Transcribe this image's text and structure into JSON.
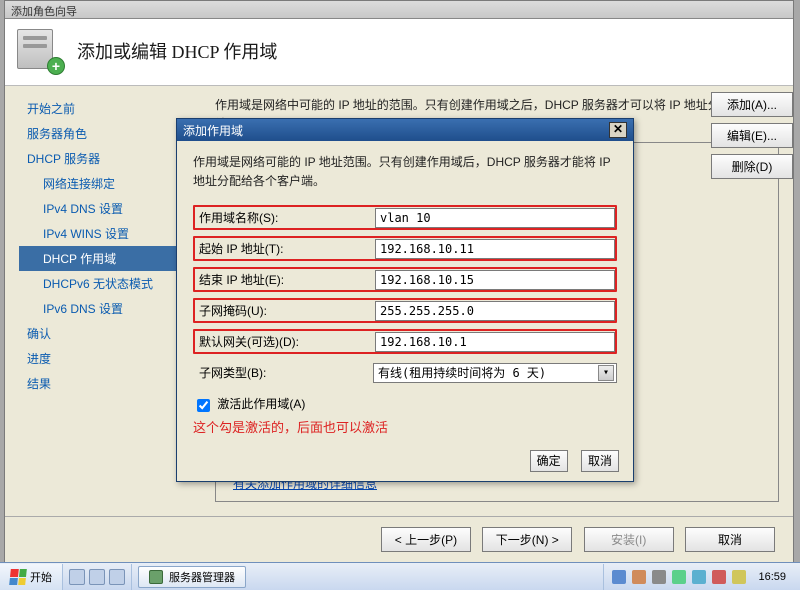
{
  "outer_titlebar": "添加角色向导",
  "wizard": {
    "title": "添加或编辑 DHCP 作用域",
    "description": "作用域是网络中可能的 IP 地址的范围。只有创建作用域之后，DHCP 服务器才可以将 IP 地址分发到客户端。"
  },
  "sidebar": {
    "items": [
      {
        "label": "开始之前",
        "sub": false,
        "name": "before-you-begin"
      },
      {
        "label": "服务器角色",
        "sub": false,
        "name": "server-roles"
      },
      {
        "label": "DHCP 服务器",
        "sub": false,
        "name": "dhcp-server"
      },
      {
        "label": "网络连接绑定",
        "sub": true,
        "name": "net-bindings"
      },
      {
        "label": "IPv4 DNS 设置",
        "sub": true,
        "name": "ipv4-dns"
      },
      {
        "label": "IPv4 WINS 设置",
        "sub": true,
        "name": "ipv4-wins"
      },
      {
        "label": "DHCP 作用域",
        "sub": true,
        "name": "dhcp-scope",
        "active": true
      },
      {
        "label": "DHCPv6 无状态模式",
        "sub": true,
        "name": "dhcpv6-stateless"
      },
      {
        "label": "IPv6 DNS 设置",
        "sub": true,
        "name": "ipv6-dns"
      },
      {
        "label": "确认",
        "sub": false,
        "name": "confirm"
      },
      {
        "label": "进度",
        "sub": false,
        "name": "progress"
      },
      {
        "label": "结果",
        "sub": false,
        "name": "result"
      }
    ]
  },
  "right_buttons": {
    "add": "添加(A)...",
    "edit": "编辑(E)...",
    "delete": "删除(D)"
  },
  "info_link": "有关添加作用域的详细信息",
  "footer": {
    "prev": "< 上一步(P)",
    "next": "下一步(N) >",
    "install": "安装(I)",
    "cancel": "取消"
  },
  "modal": {
    "title": "添加作用域",
    "desc": "作用域是网络可能的 IP 地址范围。只有创建作用域后，DHCP 服务器才能将 IP 地址分配给各个客户端。",
    "labels": {
      "scope_name": "作用域名称(S):",
      "start_ip": "起始 IP 地址(T):",
      "end_ip": "结束 IP 地址(E):",
      "mask": "子网掩码(U):",
      "gateway": "默认网关(可选)(D):",
      "subnet_type": "子网类型(B):"
    },
    "values": {
      "scope_name": "vlan 10",
      "start_ip": "192.168.10.11",
      "end_ip": "192.168.10.15",
      "mask": "255.255.255.0",
      "gateway": "192.168.10.1",
      "subnet_type": "有线(租用持续时间将为 6 天)"
    },
    "activate_label": "激活此作用域(A)",
    "activate_checked": true,
    "note": "这个勾是激活的，后面也可以激活",
    "ok": "确定",
    "cancel": "取消"
  },
  "taskbar": {
    "start": "开始",
    "active_task": "服务器管理器",
    "clock": "16:59"
  }
}
